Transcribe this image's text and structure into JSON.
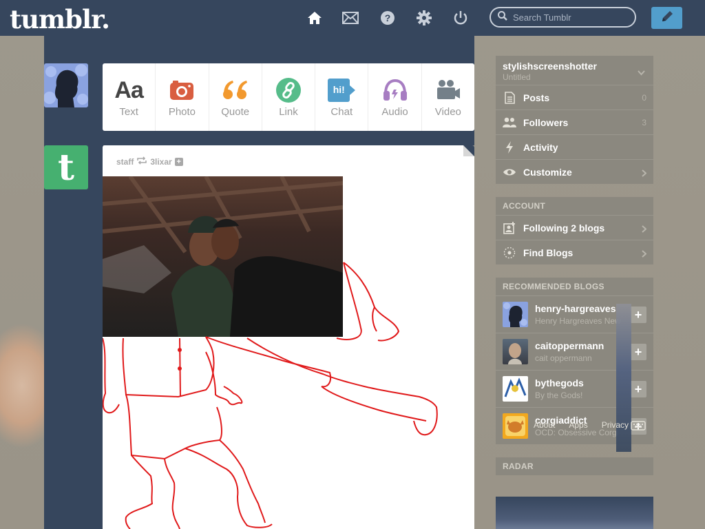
{
  "header": {
    "logo": "tumblr.",
    "search_placeholder": "Search Tumblr",
    "nav": [
      "home-icon",
      "mail-icon",
      "help-icon",
      "settings-icon",
      "power-icon"
    ],
    "compose": "pencil-icon",
    "bg": "#36465d",
    "accent": "#529ecc"
  },
  "post_types": [
    {
      "label": "Text",
      "icon": "text-icon",
      "color": "#444444"
    },
    {
      "label": "Photo",
      "icon": "camera-icon",
      "color": "#d95e40"
    },
    {
      "label": "Quote",
      "icon": "quote-icon",
      "color": "#f2992e"
    },
    {
      "label": "Link",
      "icon": "link-icon",
      "color": "#56bc8a"
    },
    {
      "label": "Chat",
      "icon": "chat-icon",
      "color": "#529ecc"
    },
    {
      "label": "Audio",
      "icon": "headphones-icon",
      "color": "#a77dc2"
    },
    {
      "label": "Video",
      "icon": "video-camera-icon",
      "color": "#748089"
    }
  ],
  "chat_badge": "hi!",
  "post": {
    "author": "staff",
    "reblogged_from": "3lixar"
  },
  "staff_avatar_letter": "t",
  "sidebar": {
    "blog_name": "stylishscreenshotter",
    "blog_title": "Untitled",
    "items": [
      {
        "label": "Posts",
        "count": "0",
        "icon": "posts-icon"
      },
      {
        "label": "Followers",
        "count": "3",
        "icon": "followers-icon"
      },
      {
        "label": "Activity",
        "icon": "lightning-icon"
      },
      {
        "label": "Customize",
        "icon": "eye-icon"
      }
    ],
    "account_title": "ACCOUNT",
    "account_items": [
      {
        "label": "Following 2 blogs",
        "icon": "following-icon"
      },
      {
        "label": "Find Blogs",
        "icon": "find-blogs-icon"
      }
    ],
    "recommended_title": "RECOMMENDED BLOGS",
    "recommended": [
      {
        "name": "henry-hargreaves",
        "subtitle": "Henry Hargreaves New"
      },
      {
        "name": "caitoppermann",
        "subtitle": "cait oppermann"
      },
      {
        "name": "bythegods",
        "subtitle": "By the Gods!"
      },
      {
        "name": "corgiaddict",
        "subtitle": "OCD: Obsessive Corgi"
      }
    ],
    "footer_links": [
      "About",
      "Apps",
      "Privacy"
    ],
    "radar_title": "RADAR"
  }
}
